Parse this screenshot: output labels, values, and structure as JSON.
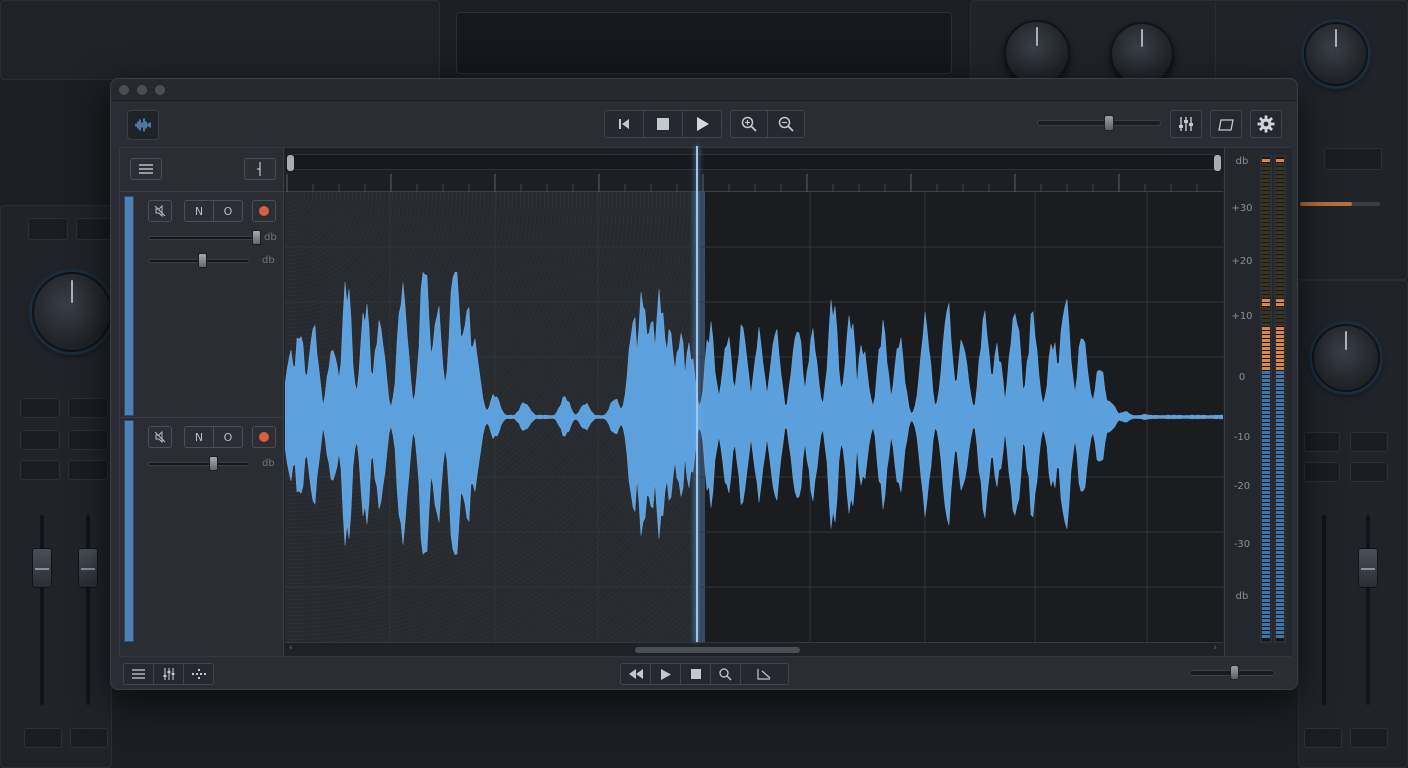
{
  "window": {
    "title_dots": [
      "close",
      "minimize",
      "zoom"
    ]
  },
  "toolbar": {
    "logo_icon": "waveform-logo-icon",
    "transport": [
      "skip-back-icon",
      "stop-icon",
      "play-icon"
    ],
    "zoom": [
      "zoom-in-icon",
      "zoom-out-icon"
    ],
    "right_buttons": [
      "mixer-icon",
      "curve-icon",
      "gear-icon"
    ],
    "volume_level": 0.6
  },
  "tracks": [
    {
      "buttons": {
        "mute_icon": "mute-icon",
        "n_label": "N",
        "o_label": "O",
        "record_icon": "record-icon"
      },
      "sliders": [
        {
          "db_label": "db",
          "level": 0.95
        },
        {
          "db_label": "db",
          "level": 0.55
        }
      ]
    },
    {
      "buttons": {
        "mute_icon": "mute-icon",
        "n_label": "N",
        "o_label": "O",
        "record_icon": "record-icon"
      },
      "sliders": [
        {
          "db_label": "db",
          "level": 0.65
        }
      ]
    }
  ],
  "meter": {
    "labels": [
      "db",
      "+30",
      "+20",
      "+10",
      "0",
      "-10",
      "-20",
      "-30",
      "db"
    ]
  },
  "scroll": {
    "left_arrow": "‹",
    "right_arrow": "›"
  },
  "bottombar": {
    "left_buttons": [
      "list-icon",
      "mixer-icon",
      "dotted-line-icon"
    ],
    "transport": [
      "rewind-icon",
      "play-icon",
      "stop-icon",
      "zoom-icon",
      "export-icon"
    ],
    "zoom_level": 0.55
  },
  "colors": {
    "waveform": "#5fa8e8",
    "accent": "#4f7fb3",
    "record": "#d9603e",
    "meter_blue": "#3f82b8",
    "meter_orange": "#d88a3a"
  }
}
